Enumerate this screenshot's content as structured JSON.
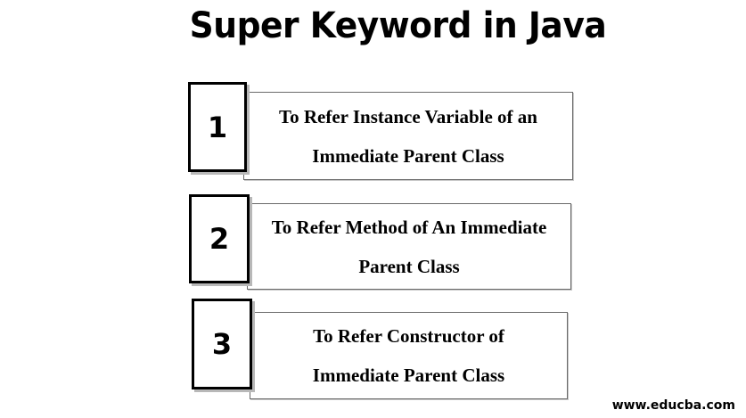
{
  "title": "Super Keyword in Java",
  "items": [
    {
      "number": "1",
      "line1": "To Refer Instance Variable of an",
      "line2": "Immediate Parent Class"
    },
    {
      "number": "2",
      "line1": "To Refer Method of An Immediate",
      "line2": "Parent Class"
    },
    {
      "number": "3",
      "line1": "To Refer Constructor of",
      "line2": "Immediate Parent Class"
    }
  ],
  "footer": "www.educba.com"
}
